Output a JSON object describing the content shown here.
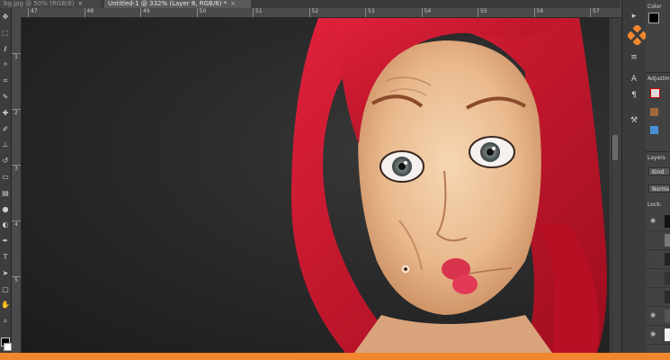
{
  "tabs": [
    {
      "label": "bg.jpg @ 50% (RGB/8)",
      "active": false
    },
    {
      "label": "Untitled-1 @ 332% (Layer 8, RGB/8) *",
      "active": true
    }
  ],
  "ruler": {
    "h_ticks": [
      "47",
      "48",
      "49",
      "50",
      "51",
      "52",
      "53",
      "54",
      "55",
      "56",
      "57"
    ],
    "v_ticks": [
      "1",
      "2",
      "3",
      "4",
      "5"
    ]
  },
  "left_tools": [
    "move-icon",
    "marquee-icon",
    "lasso-icon",
    "magic-wand-icon",
    "crop-icon",
    "eyedropper-icon",
    "healing-brush-icon",
    "brush-icon",
    "clone-stamp-icon",
    "history-brush-icon",
    "eraser-icon",
    "gradient-icon",
    "blur-icon",
    "dodge-icon",
    "pen-icon",
    "type-icon",
    "path-select-icon",
    "shape-icon",
    "hand-icon",
    "zoom-icon"
  ],
  "right_panel": {
    "color_title": "Color",
    "adjust_title": "Adjustm",
    "layers_title": "Layers",
    "kind_field": "Kind",
    "blend_field": "Normal",
    "lock_label": "Lock:"
  },
  "colors": {
    "accent": "#f1862f",
    "hair": "#d4132c",
    "panel_bg": "#424242"
  }
}
